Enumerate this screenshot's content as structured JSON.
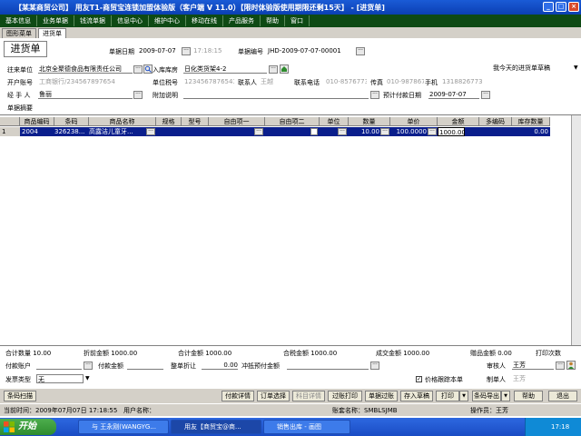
{
  "window": {
    "title": "【某某商贸公司】 用友T1-商贸宝连锁加盟体验版（客户端 V 11.0）【限时体验版使用期限还剩15天】 - [进货单]",
    "minimize": "_",
    "maximize": "□",
    "close": "×"
  },
  "menu": [
    "基本信息",
    "业务单据",
    "钱流单据",
    "信息中心",
    "维护中心",
    "移动在线",
    "产品服务",
    "帮助",
    "窗口"
  ],
  "tabs": [
    "图形菜单",
    "进货单"
  ],
  "form": {
    "doc_title": "进货单",
    "date_label": "单据日期",
    "date_value": "2009-07-07",
    "time_value": "17:18:15",
    "number_label": "单据编号",
    "number_value": "JHD-2009-07-07-00001",
    "draft_label": "我今天的进货单草稿",
    "vendor_label": "往来单位",
    "vendor_value": "北京全聚德食品有限责任公司",
    "warehouse_label": "入库库房",
    "warehouse_value": "日化类货架4-2",
    "bank_label": "开户账号",
    "bank_value": "工商银行/234567897654",
    "tax_label": "单位税号",
    "tax_value": "1234567876543",
    "contact_label": "联系人",
    "contact_value": "王越",
    "phone_label": "联系电话",
    "phone_value": "010-85767739",
    "fax_label": "传真",
    "fax_value": "010-9878678",
    "mobile_label": "手机",
    "mobile_value": "13188267731",
    "handler_label": "经 手 人",
    "handler_value": "鲁丽",
    "note_label": "附加说明",
    "note_value": "",
    "paydate_label": "预计付款日期",
    "paydate_value": "2009-07-07",
    "summary_label": "单据摘要",
    "summary_value": ""
  },
  "grid": {
    "columns": [
      "商品编码",
      "条码",
      "商品名称",
      "规格",
      "型号",
      "自由项一",
      "自由项二",
      "单位",
      "数量",
      "单价",
      "金额",
      "多编码",
      "库存数量"
    ],
    "rows": [
      {
        "index": "1",
        "code": "2004",
        "barcode": "326238...",
        "name": "高露洁儿童牙...",
        "spec": "",
        "model": "",
        "free1": "",
        "free2": "",
        "unit": "",
        "qty": "10.00",
        "price": "100.0000",
        "amount": "1000.00",
        "multicode": "",
        "stock": "0.00"
      }
    ]
  },
  "totals": {
    "qty": "合计数量 10.00",
    "discount_amt": "折前金额 1000.00",
    "total_amt": "合计金额 1000.00",
    "tax_amt": "合税金额 1000.00",
    "deal_amt": "成交金额 1000.00",
    "gift_amt": "赠品金额 0.00",
    "print_count": "打印次数"
  },
  "bottom": {
    "pay_account_label": "付款账户",
    "pay_amount_label": "付款金额",
    "discount_label": "整单折让",
    "discount_value": "0.00",
    "prepay_label": "冲抵预付金额",
    "reviewer_label": "审核人",
    "reviewer_value": "王芳",
    "invoice_label": "发票类型",
    "invoice_value": "无",
    "price_track_label": "价格跟踪本单",
    "maker_label": "制单人",
    "maker_value": "王芳"
  },
  "buttons": [
    "条码扫描",
    "付款详情",
    "订单选择",
    "科目详情",
    "过账打印",
    "单据过账",
    "存入草稿",
    "打印",
    "条码导出",
    "帮助",
    "退出"
  ],
  "status": {
    "time": "当前时间：2009年07月07日 17:18:55",
    "user": "用户名称：",
    "account": "账套名称：SMBLSJMB",
    "operator": "操作员：王芳"
  },
  "taskbar": {
    "start": "开始",
    "tasks": [
      "与 王永刚(WANGYG...",
      "用友【商贸宝@商...",
      "销售出库 - 画图"
    ],
    "clock": "17:18"
  },
  "colors": {
    "title_bg": "#0b3fb3",
    "menu_bg": "#0e4a14",
    "row_bg": "#0a1e8c",
    "taskbar_bg": "#1a4cc4"
  }
}
